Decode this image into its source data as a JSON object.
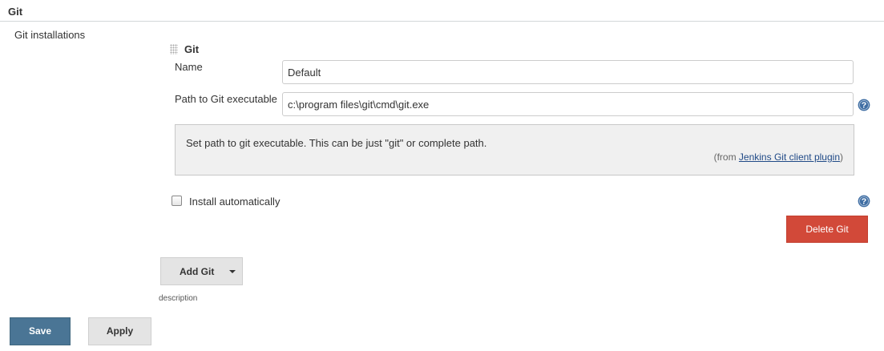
{
  "section": {
    "title": "Git"
  },
  "installations": {
    "label": "Git installations",
    "block_title": "Git",
    "name_label": "Name",
    "name_value": "Default",
    "path_label": "Path to Git executable",
    "path_value": "c:\\program files\\git\\cmd\\git.exe",
    "help": {
      "text": "Set path to git executable. This can be just \"git\" or complete path.",
      "from_prefix": "(from ",
      "from_link": "Jenkins Git client plugin",
      "from_suffix": ")"
    },
    "install_auto_label": "Install automatically",
    "install_auto_checked": false,
    "delete_label": "Delete Git",
    "add_label": "Add Git",
    "description_label": "description"
  },
  "footer": {
    "save_label": "Save",
    "apply_label": "Apply"
  },
  "colors": {
    "delete_button": "#d24939",
    "save_button": "#4a7595",
    "help_icon": "#3f6ea3",
    "link": "#204a87"
  },
  "icons": {
    "help": "help-icon",
    "drag": "drag-handle-icon",
    "dropdown": "caret-down-icon"
  }
}
